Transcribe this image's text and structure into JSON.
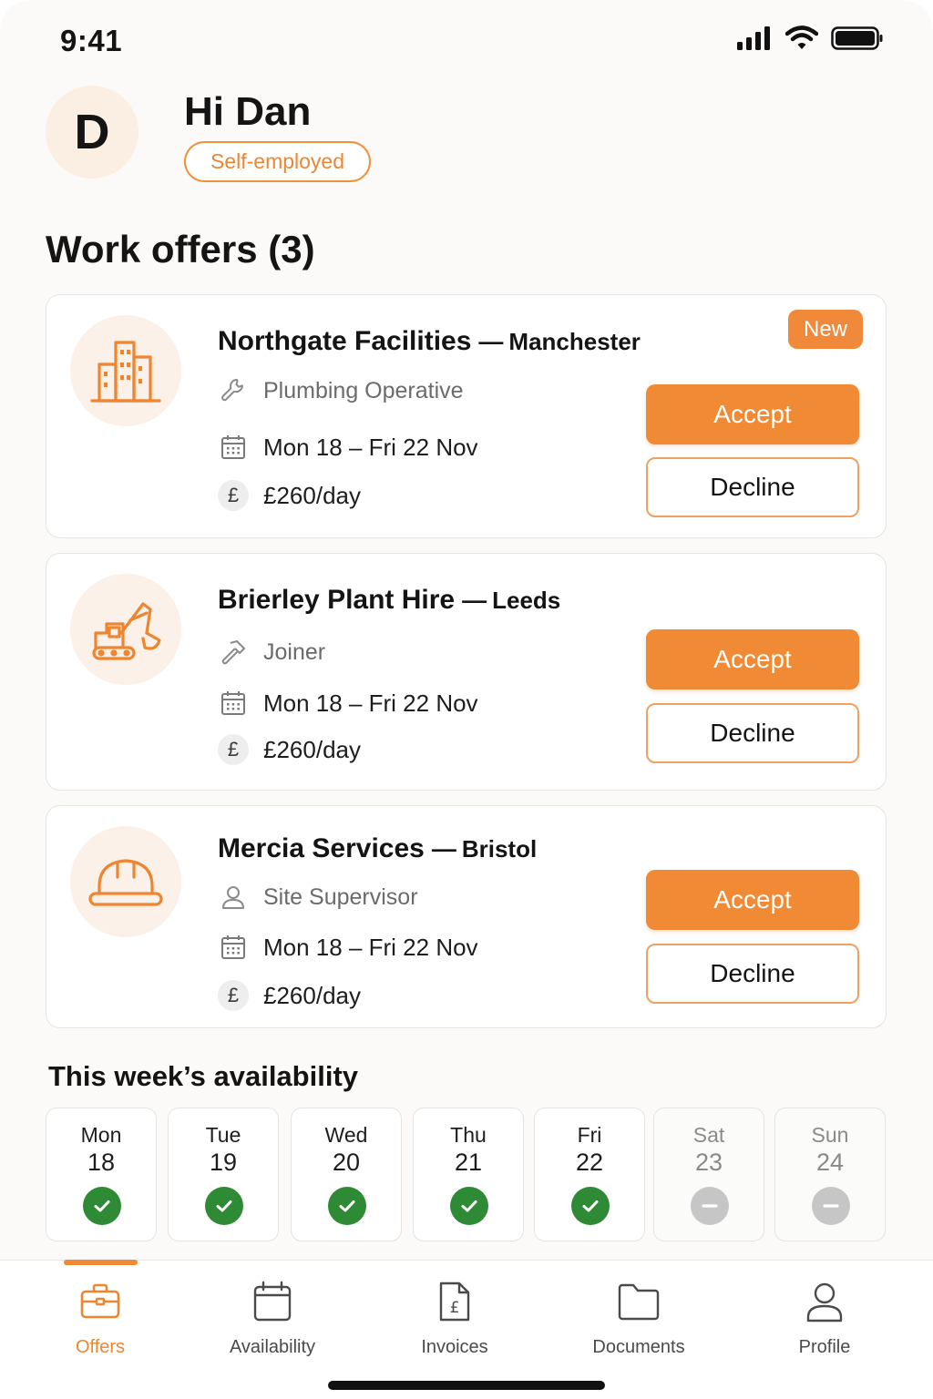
{
  "status_bar": {
    "time": "9:41"
  },
  "header": {
    "avatar_initial": "D",
    "greeting": "Hi Dan",
    "employment_badge": "Self-employed"
  },
  "offers_title": "Work offers (3)",
  "offers": [
    {
      "company": "Northgate Facilities",
      "separator": "—",
      "city": "Manchester",
      "icon": "building-icon",
      "role": "Plumbing Operative",
      "role_icon": "wrench-icon",
      "dates": "Mon 18 – Fri 22 Nov",
      "currency_symbol": "£",
      "rate": "£260/day",
      "badge": "New",
      "accept_label": "Accept",
      "decline_label": "Decline"
    },
    {
      "company": "Brierley Plant Hire",
      "separator": "—",
      "city": "Leeds",
      "icon": "excavator-icon",
      "role": "Joiner",
      "role_icon": "hammer-icon",
      "dates": "Mon 18 – Fri 22 Nov",
      "currency_symbol": "£",
      "rate": "£260/day",
      "accept_label": "Accept",
      "decline_label": "Decline"
    },
    {
      "company": "Mercia Services",
      "separator": "—",
      "city": "Bristol",
      "icon": "hard-hat-icon",
      "role": "Site Supervisor",
      "role_icon": "person-icon",
      "dates": "Mon 18 – Fri 22 Nov",
      "currency_symbol": "£",
      "rate": "£260/day",
      "accept_label": "Accept",
      "decline_label": "Decline"
    }
  ],
  "availability": {
    "title": "This week’s availability",
    "days": [
      {
        "day": "Mon",
        "date": "18",
        "status": "available"
      },
      {
        "day": "Tue",
        "date": "19",
        "status": "available"
      },
      {
        "day": "Wed",
        "date": "20",
        "status": "available"
      },
      {
        "day": "Thu",
        "date": "21",
        "status": "available"
      },
      {
        "day": "Fri",
        "date": "22",
        "status": "available"
      },
      {
        "day": "Sat",
        "date": "23",
        "status": "unavailable"
      },
      {
        "day": "Sun",
        "date": "24",
        "status": "unavailable"
      }
    ]
  },
  "tab_bar": {
    "active": "Offers",
    "items": [
      {
        "label": "Offers",
        "icon": "briefcase-icon"
      },
      {
        "label": "Availability",
        "icon": "calendar-icon"
      },
      {
        "label": "Invoices",
        "icon": "invoice-icon"
      },
      {
        "label": "Documents",
        "icon": "folder-icon"
      },
      {
        "label": "Profile",
        "icon": "profile-icon"
      }
    ]
  },
  "colors": {
    "accent": "#f08a34",
    "available": "#2f8a36",
    "unavailable": "#c6c6c6"
  }
}
